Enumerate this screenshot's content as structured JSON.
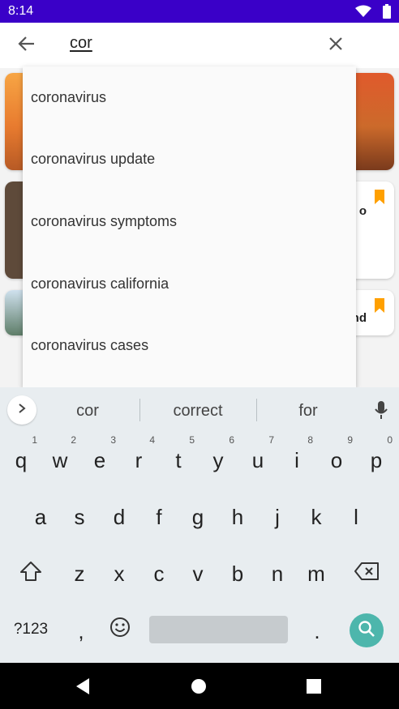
{
  "status_bar": {
    "time": "8:14",
    "icons": [
      "wifi-icon",
      "battery-icon"
    ]
  },
  "search": {
    "query": "cor",
    "icons": [
      "arrow-back-icon",
      "close-icon"
    ]
  },
  "background_cards": [
    {
      "text_fragment": ""
    },
    {
      "text_fragment": "o"
    },
    {
      "text_fragment": "nd"
    }
  ],
  "suggestions": [
    "coronavirus",
    "coronavirus update",
    "coronavirus symptoms",
    "coronavirus california",
    "coronavirus cases"
  ],
  "keyboard": {
    "suggestions": [
      "cor",
      "correct",
      "for"
    ],
    "row1": [
      {
        "key": "q",
        "hint": "1"
      },
      {
        "key": "w",
        "hint": "2"
      },
      {
        "key": "e",
        "hint": "3"
      },
      {
        "key": "r",
        "hint": "4"
      },
      {
        "key": "t",
        "hint": "5"
      },
      {
        "key": "y",
        "hint": "6"
      },
      {
        "key": "u",
        "hint": "7"
      },
      {
        "key": "i",
        "hint": "8"
      },
      {
        "key": "o",
        "hint": "9"
      },
      {
        "key": "p",
        "hint": "0"
      }
    ],
    "row2": [
      "a",
      "s",
      "d",
      "f",
      "g",
      "h",
      "j",
      "k",
      "l"
    ],
    "row3": [
      "z",
      "x",
      "c",
      "v",
      "b",
      "n",
      "m"
    ],
    "row4": {
      "symbols": "?123",
      "comma": ",",
      "period": "."
    },
    "icons": [
      "expand-icon",
      "mic-icon",
      "shift-icon",
      "backspace-icon",
      "emoji-icon",
      "search-icon"
    ]
  },
  "nav_bar": {
    "icons": [
      "back-triangle-icon",
      "home-circle-icon",
      "recents-square-icon"
    ]
  },
  "colors": {
    "status_bar": "#3a00c8",
    "bookmark": "#ffa000",
    "search_key": "#4db6ac",
    "keyboard_bg": "#e8edf0"
  }
}
